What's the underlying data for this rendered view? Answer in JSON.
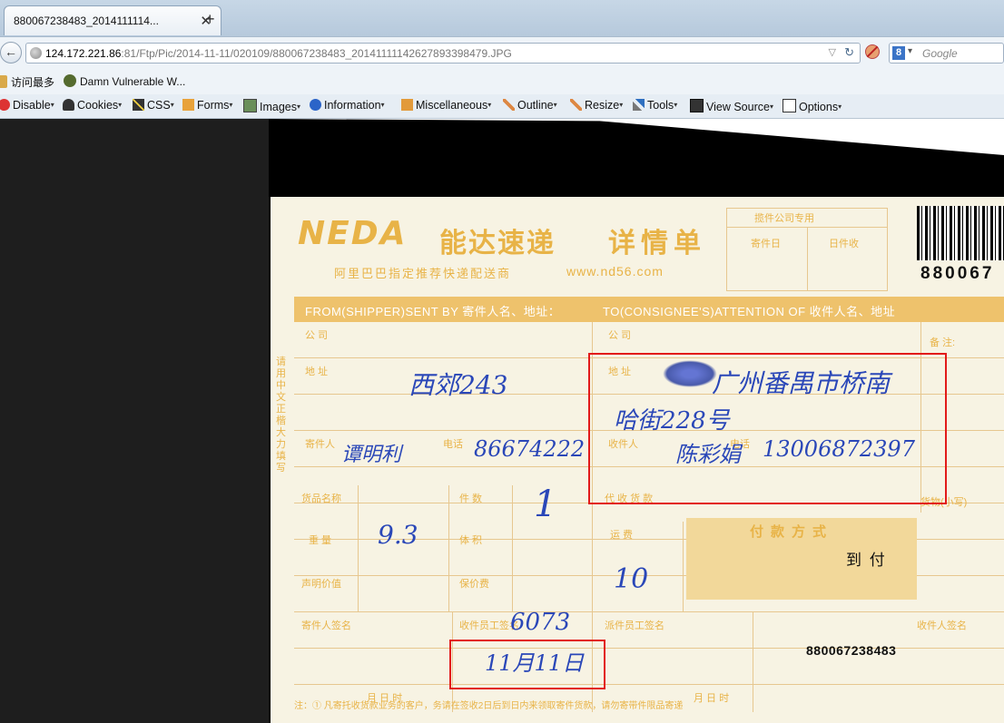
{
  "tab": {
    "title": "880067238483_2014111114...",
    "close": "✕",
    "new_tab": "+"
  },
  "nav": {
    "back": "←",
    "url_host": "124.172.221.86",
    "url_rest": ":81/Ftp/Pic/2014-11-11/020109/880067238483_20141111142627893 98479.JPG",
    "url_full_path": ":81/Ftp/Pic/2014-11-11/020109/880067238483_20141111142627893984 79.JPG",
    "url_path": ":81/Ftp/Pic/2014-11-11/020109/880067238483_20141111142627893 98479.JPG",
    "search_engine": "8",
    "search_placeholder": "Google"
  },
  "bookmarks": [
    {
      "label": "访问最多"
    },
    {
      "label": "Damn Vulnerable W..."
    }
  ],
  "devbar": [
    {
      "label": "Disable"
    },
    {
      "label": "Cookies"
    },
    {
      "label": "CSS"
    },
    {
      "label": "Forms"
    },
    {
      "label": "Images"
    },
    {
      "label": "Information"
    },
    {
      "label": "Miscellaneous"
    },
    {
      "label": "Outline"
    },
    {
      "label": "Resize"
    },
    {
      "label": "Tools"
    },
    {
      "label": "View Source"
    },
    {
      "label": "Options"
    }
  ],
  "waybill": {
    "logo": "NEDA",
    "brand_cn": "能达速递",
    "title_cn": "详情单",
    "slogan": "阿里巴巴指定推荐快递配送商",
    "website": "www.nd56.com",
    "barcode_number": "880067",
    "stamp_title": "揽件公司专用",
    "stamp_label_1": "寄件日",
    "stamp_label_2": "日件收",
    "from_bar": "FROM(SHIPPER)SENT BY 寄件人名、地址：",
    "to_bar": "TO(CONSIGNEE'S)ATTENTION OF 收件人名、地址",
    "company_label": "公 司",
    "company_label_to": "公 司",
    "address_label": "地 址",
    "address_label_to": "地 址",
    "shipper_label": "寄件人",
    "phone_label": "电话",
    "receiver_label": "收件人",
    "phone_label_to": "电话",
    "remark_label": "备 注:",
    "item_label": "货品名称",
    "qty_label": "件 数",
    "cod_label": "代 收 货 款",
    "weight_label": "重 量",
    "volume_label": "体 积",
    "fee_label": "运 费",
    "declared_label": "声明价值",
    "insurance_label": "保价费",
    "pay_title": "付款方式",
    "pay_daofu": "到 付",
    "sender_sign_label": "寄件人签名",
    "pickup_label": "收件员工签名",
    "delivery_label": "派件员工签名",
    "receiver_sign_label": "收件人签名",
    "date_label": "月    日    时",
    "tracking": "880067238483",
    "goods_small": "货物(小写)",
    "side_text": "请用中文正楷大力填写",
    "footer": "注：① 凡寄托收货款业务的客户，务请在签收2日后到日内来领取寄件货款，请勿寄带件限品寄递"
  },
  "handwriting": {
    "from_address": "西郊243",
    "shipper_name": "谭明利",
    "shipper_phone": "86674222",
    "qty": "1",
    "weight": "9.3",
    "fee": "10",
    "to_address_1": "广州番禺市桥南",
    "to_address_2": "哈街228号",
    "receiver_name": "陈彩娟",
    "receiver_phone": "13006872397",
    "courier_id": "6073",
    "date": "11月11日"
  },
  "colors": {
    "accent": "#e8b347",
    "ink": "#2a47b8",
    "highlight": "#e21a1a"
  }
}
